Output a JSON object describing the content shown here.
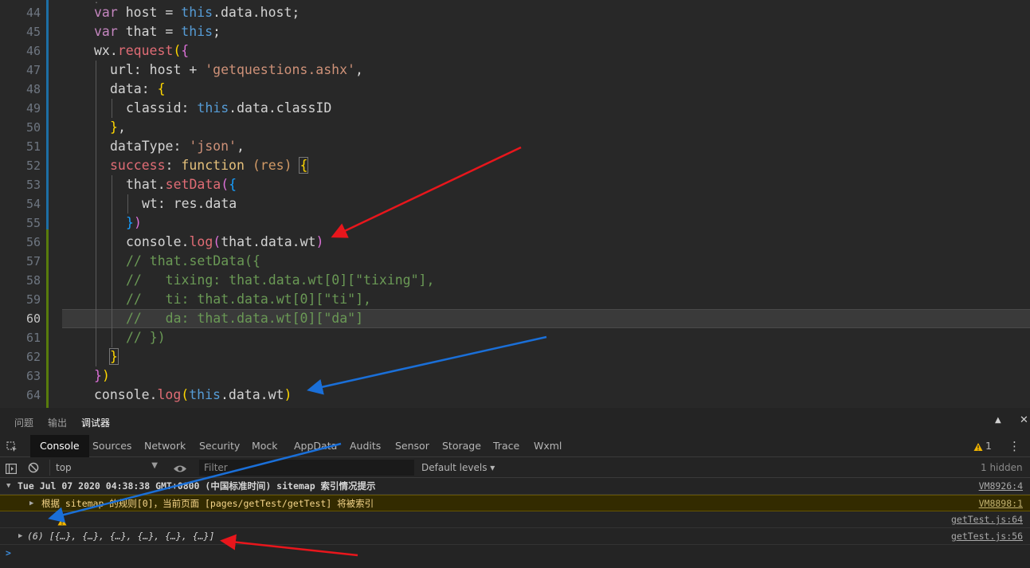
{
  "editor": {
    "lines": [
      {
        "n": "44"
      },
      {
        "n": "45"
      },
      {
        "n": "46"
      },
      {
        "n": "47"
      },
      {
        "n": "48"
      },
      {
        "n": "49"
      },
      {
        "n": "50"
      },
      {
        "n": "51"
      },
      {
        "n": "52"
      },
      {
        "n": "53"
      },
      {
        "n": "54"
      },
      {
        "n": "55"
      },
      {
        "n": "56"
      },
      {
        "n": "57"
      },
      {
        "n": "58"
      },
      {
        "n": "59"
      },
      {
        "n": "60"
      },
      {
        "n": "61"
      },
      {
        "n": "62"
      },
      {
        "n": "63"
      },
      {
        "n": "64"
      }
    ]
  },
  "panel": {
    "tabs": [
      "问题",
      "输出",
      "调试器"
    ],
    "maximize_glyph": "▲",
    "close_glyph": "✕"
  },
  "devtools": {
    "tabs": [
      "Console",
      "Sources",
      "Network",
      "Security",
      "Mock",
      "AppData",
      "Audits",
      "Sensor",
      "Storage",
      "Trace",
      "Wxml"
    ],
    "warning_count": "1",
    "more_glyph": "⋮"
  },
  "filterbar": {
    "context": "top",
    "filter_placeholder": "Filter",
    "levels": "Default levels ▾",
    "hidden": "1 hidden"
  },
  "console": {
    "group_header": "Tue Jul 07 2020 04:38:38 GMT+0800 (中国标准时间) sitemap 索引情况提示",
    "group_src": "VM8926:4",
    "warning_text": "根据 sitemap 的规则[0]，当前页面 [pages/getTest/getTest] 将被索引",
    "warning_src": "VM8898:1",
    "empty_src": "getTest.js:64",
    "array_text": "(6) [{…}, {…}, {…}, {…}, {…}, {…}]",
    "array_src": "getTest.js:56",
    "prompt": ">"
  },
  "colors": {
    "arrow_red": "#e8161c",
    "arrow_blue": "#1a6fd8"
  }
}
